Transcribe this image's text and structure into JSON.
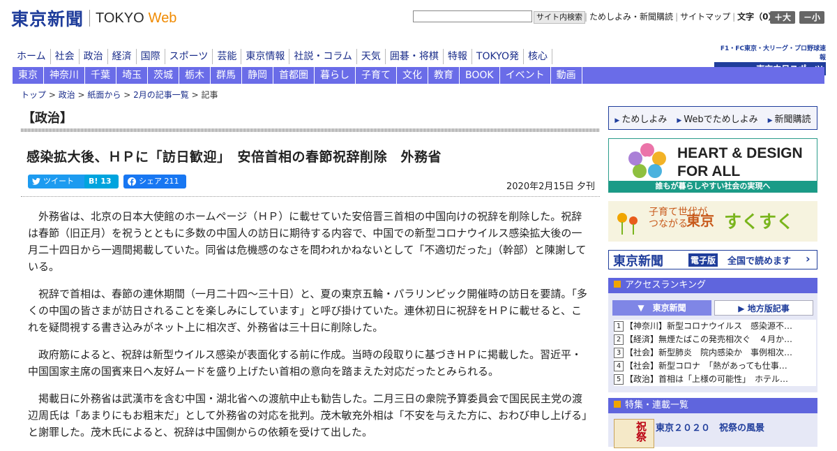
{
  "header": {
    "logo_jp": "東京新聞",
    "logo_en": "TOKYO",
    "logo_web": "Web",
    "search_placeholder": "",
    "search_button": "サイト内検索",
    "links": [
      "ためしよみ・新聞購読",
      "サイトマップ"
    ],
    "font_size_label": "文字（0）",
    "font_larger": "＋大",
    "font_smaller": "－小"
  },
  "main_nav": [
    "ホーム",
    "社会",
    "政治",
    "経済",
    "国際",
    "スポーツ",
    "芸能",
    "東京情報",
    "社説・コラム",
    "天気",
    "囲碁・将棋",
    "特報",
    "TOKYO発",
    "核心"
  ],
  "chunichi": {
    "line1": "F1・FC東京・大リーグ・プロ野球速報",
    "line2": "東京中日スポーツ"
  },
  "sub_nav": [
    "東京",
    "神奈川",
    "千葉",
    "埼玉",
    "茨城",
    "栃木",
    "群馬",
    "静岡",
    "首都圏",
    "暮らし",
    "子育て",
    "文化",
    "教育",
    "BOOK",
    "イベント",
    "動画"
  ],
  "breadcrumb": [
    "トップ",
    "政治",
    "紙面から",
    "2月の記事一覧",
    "記事"
  ],
  "section_title": "【政治】",
  "article": {
    "headline": "感染拡大後、ＨＰに「訪日歓迎」　安倍首相の春節祝辞削除　外務省",
    "tweet_label": "ツイート",
    "hatena_count": "13",
    "fb_label": "シェア 211",
    "date": "2020年2月15日 夕刊",
    "paragraphs": [
      "外務省は、北京の日本大使館のホームページ（ＨＰ）に載せていた安倍晋三首相の中国向けの祝辞を削除した。祝辞は春節（旧正月）を祝うとともに多数の中国人の訪日に期待する内容で、中国での新型コロナウイルス感染拡大後の一月二十四日から一週間掲載していた。同省は危機感のなさを問われかねないとして「不適切だった」（幹部）と陳謝している。",
      "祝辞で首相は、春節の連休期間（一月二十四～三十日）と、夏の東京五輪・パラリンピック開催時の訪日を要請。「多くの中国の皆さまが訪日されることを楽しみにしています」と呼び掛けていた。連休初日に祝辞をＨＰに載せると、これを疑問視する書き込みがネット上に相次ぎ、外務省は三十日に削除した。",
      "政府筋によると、祝辞は新型ウイルス感染が表面化する前に作成。当時の段取りに基づきＨＰに掲載した。習近平・中国国家主席の国賓来日へ友好ムードを盛り上げたい首相の意向を踏まえた対応だったとみられる。",
      "掲載日に外務省は武漢市を含む中国・湖北省への渡航中止も勧告した。二月三日の衆院予算委員会で国民民主党の渡辺周氏は「あまりにもお粗末だ」として外務省の対応を批判。茂木敏充外相は「不安を与えた方に、おわび申し上げる」と謝罪した。茂木氏によると、祝辞は中国側からの依頼を受けて出した。"
    ]
  },
  "sidebar": {
    "trial_links": [
      "ためしよみ",
      "Webでためしよみ",
      "新聞購読"
    ],
    "heart": {
      "line1": "HEART & DESIGN",
      "line2": "FOR ALL",
      "sub": "誰もが暮らしやすい社会の実現へ"
    },
    "sukusuku": {
      "a1": "子育て世代が",
      "a2": "つながる",
      "b": "東京",
      "c": "すくすく"
    },
    "denshiban": {
      "a": "東京新聞",
      "b": "電子版",
      "c": "全国で読めます"
    },
    "ranking": {
      "title": "アクセスランキング",
      "tab1": "東京新聞",
      "tab2": "地方版記事",
      "items": [
        "【神奈川】新型コロナウイルス　感染源不…",
        "【経済】無煙たばこの発売相次ぐ　４月か…",
        "【社会】新型肺炎　院内感染か　事例相次…",
        "【社会】新型コロナ　「熱があっても仕事…",
        "【政治】首相は「上様の可能性」　ホテル…"
      ]
    },
    "features": {
      "title": "特集・連載一覧",
      "thumb_text": "祝祭",
      "first": "東京２０２０　祝祭の風景"
    }
  },
  "colors": {
    "brand_blue": "#1f3d9b",
    "subnav_bg": "#6a6ce8",
    "accent_orange": "#f08a00"
  }
}
